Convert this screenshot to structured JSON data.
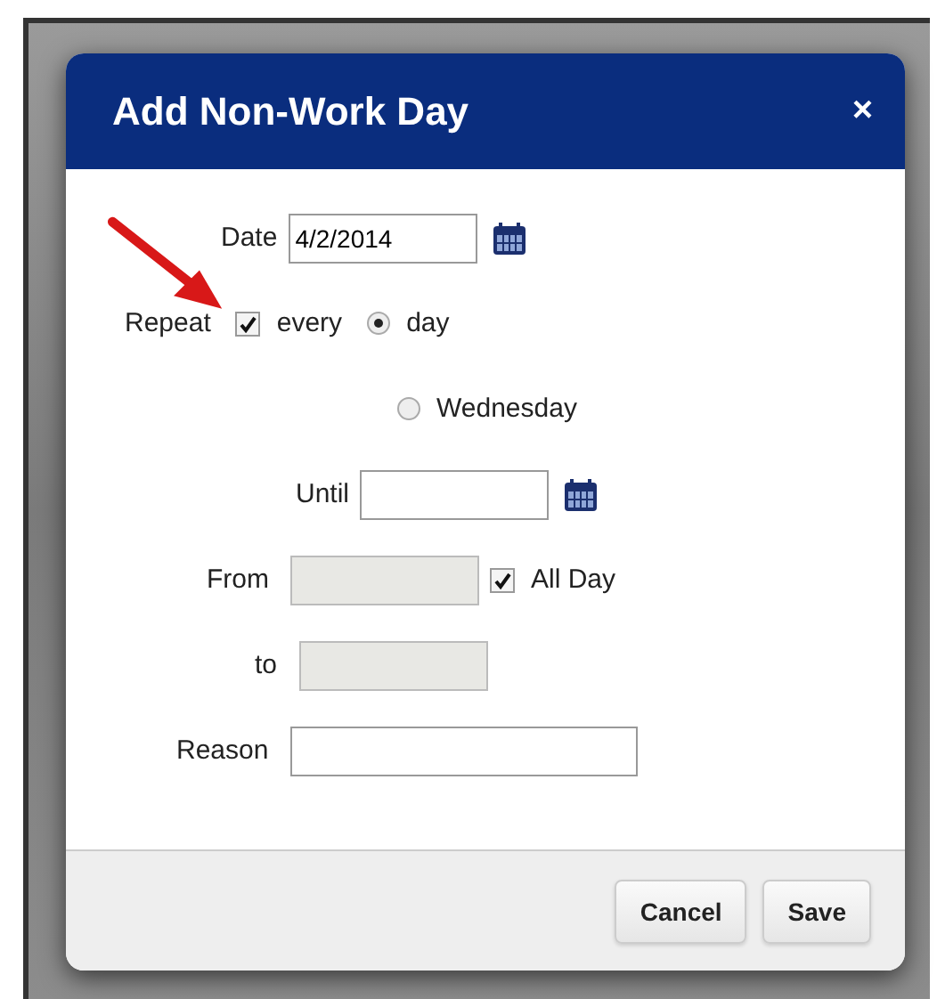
{
  "dialog": {
    "title": "Add Non-Work Day",
    "close": "×",
    "rows": [
      {
        "parts": [
          {
            "kind": "label",
            "text": "Date"
          },
          {
            "kind": "input",
            "value": "4/2/2014",
            "disabled": false
          },
          {
            "kind": "calendar"
          }
        ]
      },
      {
        "parts": [
          {
            "kind": "label",
            "text": "Repeat"
          },
          {
            "kind": "checkbox",
            "checked": true,
            "label": "every"
          },
          {
            "kind": "radio",
            "selected": true,
            "label": "day"
          }
        ]
      },
      {
        "parts": [
          {
            "kind": "radio",
            "selected": false,
            "label": "Wednesday"
          }
        ]
      },
      {
        "parts": [
          {
            "kind": "label",
            "text": "Until"
          },
          {
            "kind": "input",
            "disabled": false
          },
          {
            "kind": "calendar"
          }
        ]
      },
      {
        "parts": [
          {
            "kind": "label",
            "text": "From"
          },
          {
            "kind": "input",
            "disabled": true
          },
          {
            "kind": "checkbox",
            "checked": true,
            "label": "All Day"
          }
        ]
      },
      {
        "parts": [
          {
            "kind": "label",
            "text": "to"
          },
          {
            "kind": "input",
            "disabled": true
          }
        ]
      },
      {
        "parts": [
          {
            "kind": "label",
            "text": "Reason"
          },
          {
            "kind": "input",
            "disabled": false
          }
        ]
      }
    ],
    "buttons": [
      "Cancel",
      "Save"
    ]
  }
}
